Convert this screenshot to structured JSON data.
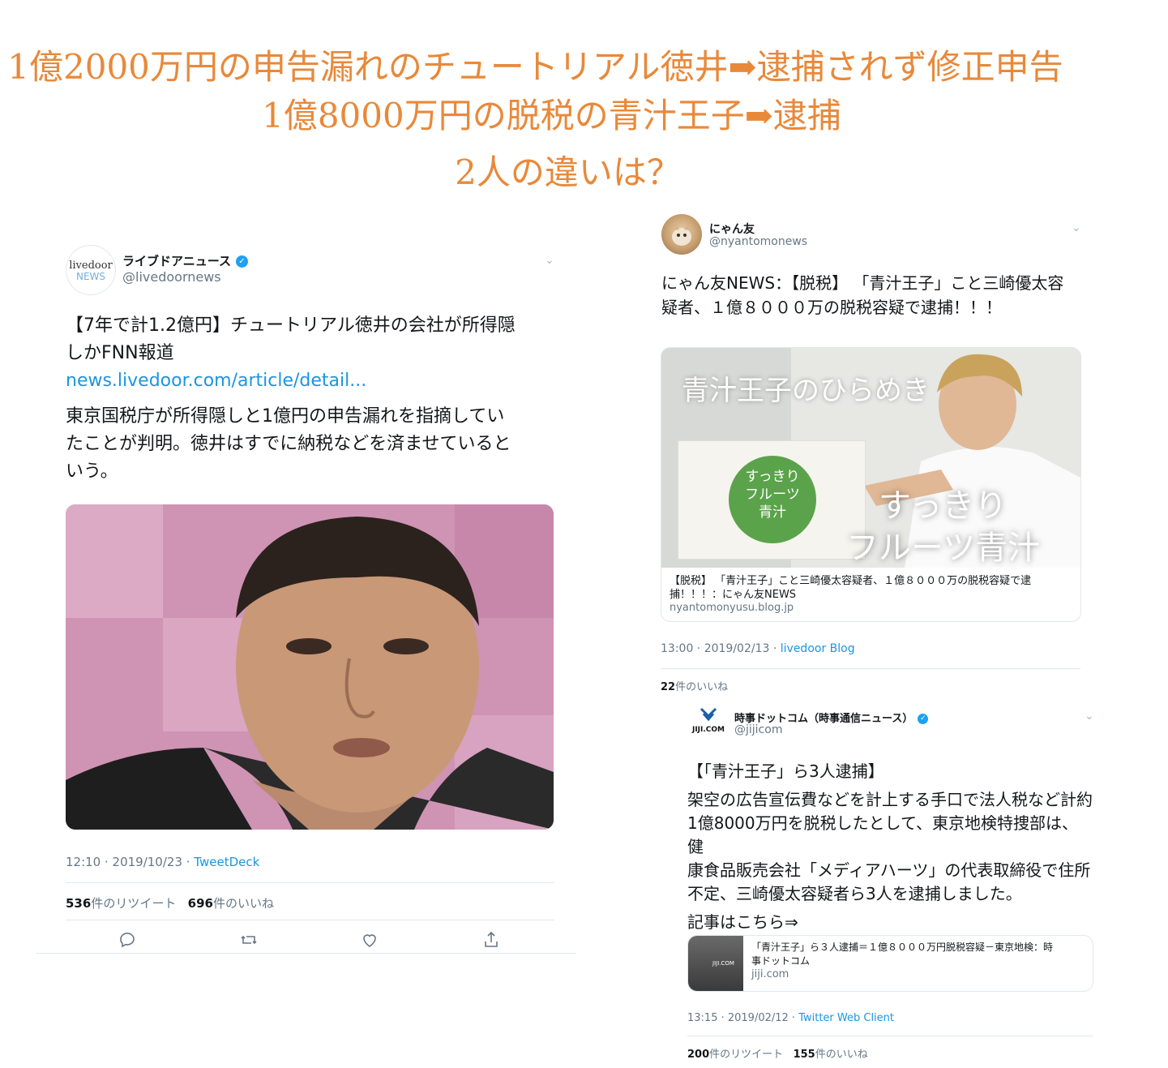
{
  "headline": {
    "line1": "1億2000万円の申告漏れのチュートリアル徳井➡逮捕されず修正申告",
    "line2": "1億8000万円の脱税の青汁王子➡逮捕",
    "line3": "2人の違いは？"
  },
  "tweet_left": {
    "avatar_text_top": "livedoor",
    "avatar_text_bottom": "NEWS",
    "name": "ライブドアニュース",
    "handle": "@livedoornews",
    "text_line1": "【7年で計1.2億円】チュートリアル徳井の会社が所得隠",
    "text_line2": "しかFNN報道",
    "link": "news.livedoor.com/article/detail...",
    "text2_line1": "東京国税庁が所得隠しと1億円の申告漏れを指摘してい",
    "text2_line2": "たことが判明。徳井はすでに納税などを済ませていると",
    "text2_line3": "いう。",
    "time": "12:10 · 2019/10/23 · ",
    "source": "TweetDeck",
    "retweets": "536",
    "retweets_label": "件のリツイート",
    "likes": "696",
    "likes_label": "件のいいね"
  },
  "tweet_right": {
    "name": "にゃん友",
    "handle": "@nyantomonews",
    "text_line1": "にゃん友NEWS：【脱税】 「青汁王子」こと三崎優太容",
    "text_line2": "疑者、１億８０００万の脱税容疑で逮捕！！！",
    "image_overlay_title": "青汁王子のひらめき",
    "image_overlay_product_line1": "すっきり",
    "image_overlay_product_line2": "フルーツ青汁",
    "image_package_text_line1": "すっきり",
    "image_package_text_line2": "フルーツ",
    "image_package_text_line3": "青汁",
    "card_title_line1": "【脱税】 「青汁王子」こと三崎優太容疑者、１億８０００万の脱税容疑で逮",
    "card_title_line2": "捕！！！：にゃん友NEWS",
    "card_domain": "nyantomonyusu.blog.jp",
    "time": "13:00 · 2019/02/13 · ",
    "source": "livedoor Blog",
    "likes": "22",
    "likes_label": "件のいいね"
  },
  "tweet_jiji": {
    "logo_text": "JIJI.COM",
    "name": "時事ドットコム（時事通信ニュース）",
    "handle": "@jijicom",
    "title": "【「青汁王子」ら3人逮捕】",
    "body_line1": "架空の広告宣伝費などを計上する手口で法人税など計約",
    "body_line2": "1億8000万円を脱税したとして、東京地検特捜部は、健",
    "body_line3": "康食品販売会社「メディアハーツ」の代表取締役で住所",
    "body_line4": "不定、三崎優太容疑者ら3人を逮捕しました。",
    "body_line5": "記事はこちら⇒",
    "card_title_line1": "「青汁王子」ら３人逮捕＝１億８０００万円脱税容疑－東京地検：時",
    "card_title_line2": "事ドットコム",
    "card_domain": "jiji.com",
    "card_thumb_text": "JIJI.COM",
    "time": "13:15 · 2019/02/12 · ",
    "source": "Twitter Web Client",
    "retweets": "200",
    "retweets_label": "件のリツイート",
    "likes": "155",
    "likes_label": "件のいいね"
  },
  "icons": [
    "verified-badge-icon",
    "chevron-down-icon",
    "reply-icon",
    "retweet-icon",
    "like-icon",
    "share-icon"
  ],
  "colors": {
    "headline": "#e8893a",
    "link": "#1b95e0",
    "verified": "#1da1f2",
    "muted": "#657786"
  }
}
